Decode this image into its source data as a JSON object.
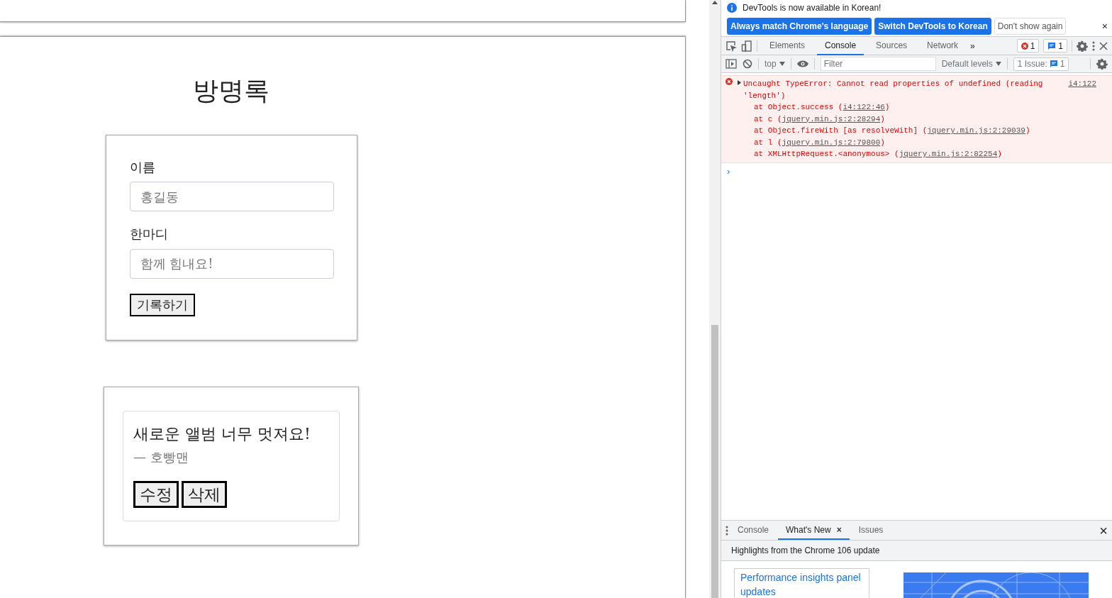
{
  "page": {
    "title": "방명록",
    "form": {
      "fields": [
        {
          "label": "이름",
          "placeholder": "홍길동"
        },
        {
          "label": "한마디",
          "placeholder": "함께 힘내요!"
        }
      ],
      "submit": "기록하기"
    },
    "entries": [
      {
        "message": "새로운 앨범 너무 멋져요!",
        "author": "— 호빵맨",
        "buttons": [
          "수정",
          "삭제"
        ]
      }
    ]
  },
  "devtools": {
    "infobar": {
      "message": "DevTools is now available in Korean!",
      "buttons": [
        {
          "label": "Always match Chrome's language",
          "kind": "primary"
        },
        {
          "label": "Switch DevTools to Korean",
          "kind": "primary"
        },
        {
          "label": "Don't show again",
          "kind": "secondary"
        }
      ],
      "close": "×"
    },
    "tabs": [
      {
        "label": "Elements",
        "selected": false
      },
      {
        "label": "Console",
        "selected": true
      },
      {
        "label": "Sources",
        "selected": false
      },
      {
        "label": "Network",
        "selected": false
      }
    ],
    "more": "»",
    "error_count": "1",
    "info_count": "1",
    "console_toolbar": {
      "context": "top",
      "filter_placeholder": "Filter",
      "levels": "Default levels",
      "issues_label": "1 Issue:",
      "issues_count": "1"
    },
    "messages": [
      {
        "kind": "error",
        "text": "Uncaught TypeError: Cannot read properties of undefined (reading 'length')",
        "source": "i4:122",
        "expanded": false,
        "stack": [
          {
            "before": "at Object.success (",
            "link": "i4:122:46",
            "after": ")"
          },
          {
            "before": "at c (",
            "link": "jquery.min.js:2:28294",
            "after": ")"
          },
          {
            "before": "at Object.fireWith [as resolveWith] (",
            "link": "jquery.min.js:2:29039",
            "after": ")"
          },
          {
            "before": "at l (",
            "link": "jquery.min.js:2:79800",
            "after": ")"
          },
          {
            "before": "at XMLHttpRequest.<anonymous> (",
            "link": "jquery.min.js:2:82254",
            "after": ")"
          }
        ]
      }
    ],
    "prompt": "›",
    "drawer": {
      "tabs": [
        {
          "label": "Console",
          "selected": false,
          "closable": false
        },
        {
          "label": "What's New",
          "selected": true,
          "closable": true
        },
        {
          "label": "Issues",
          "selected": false,
          "closable": false
        }
      ],
      "close_tab": "×",
      "close": "×",
      "heading": "Highlights from the Chrome 106 update",
      "link": "Performance insights panel updates"
    }
  }
}
